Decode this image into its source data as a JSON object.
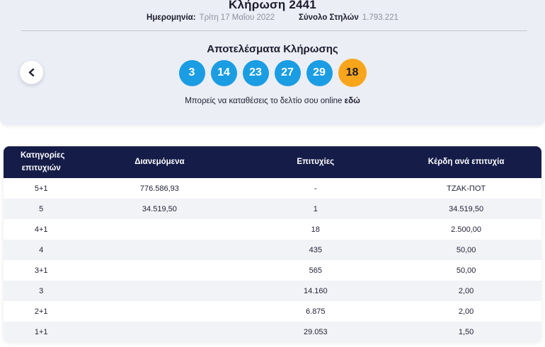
{
  "header": {
    "title": "Κλήρωση 2441",
    "date_label": "Ημερομηνία:",
    "date_value": "Τρίτη 17 Μαΐου 2022",
    "columns_label": "Σύνολο Στηλών",
    "columns_value": "1.793.221"
  },
  "results": {
    "heading": "Αποτελέσματα Κλήρωσης",
    "numbers": [
      "3",
      "14",
      "23",
      "27",
      "29"
    ],
    "joker_number": "18",
    "deposit_text": "Μπορείς να καταθέσεις το δελτίο σου online ",
    "deposit_link": "εδώ"
  },
  "colors": {
    "ball_blue": "#1b9de3",
    "ball_joker_orange": "#f9a51b",
    "table_header_navy": "#151c48",
    "panel_gray": "#ebeef5"
  },
  "table": {
    "headers": [
      "Κατηγορίες επιτυχιών",
      "Διανεμόμενα",
      "Επιτυχίες",
      "Κέρδη ανά επιτυχία"
    ],
    "rows": [
      {
        "category": "5+1",
        "distributed": "776.586,93",
        "winners": "-",
        "prize": "ΤΖΑΚ-ΠΟΤ"
      },
      {
        "category": "5",
        "distributed": "34.519,50",
        "winners": "1",
        "prize": "34.519,50"
      },
      {
        "category": "4+1",
        "distributed": "",
        "winners": "18",
        "prize": "2.500,00"
      },
      {
        "category": "4",
        "distributed": "",
        "winners": "435",
        "prize": "50,00"
      },
      {
        "category": "3+1",
        "distributed": "",
        "winners": "565",
        "prize": "50,00"
      },
      {
        "category": "3",
        "distributed": "",
        "winners": "14.160",
        "prize": "2,00"
      },
      {
        "category": "2+1",
        "distributed": "",
        "winners": "6.875",
        "prize": "2,00"
      },
      {
        "category": "1+1",
        "distributed": "",
        "winners": "29.053",
        "prize": "1,50"
      }
    ]
  }
}
